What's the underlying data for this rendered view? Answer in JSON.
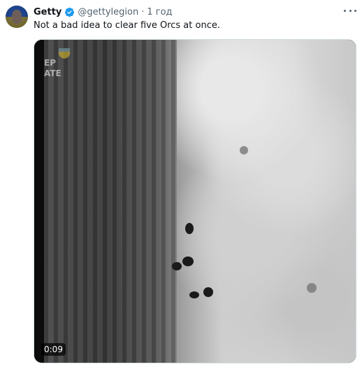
{
  "tweet": {
    "author_name": "Getty",
    "handle": "@gettylegion",
    "separator": "·",
    "time": "1 год",
    "text": "Not a bad idea to clear five Orcs at once.",
    "verified_icon": "verified-badge-icon",
    "more_icon": "more-options-icon",
    "colors": {
      "verified": "#1d9bf0",
      "secondary_text": "#536471",
      "primary_text": "#0f1419"
    }
  },
  "media": {
    "overlay_text": "EP\nATE",
    "video_time": "0:09"
  }
}
